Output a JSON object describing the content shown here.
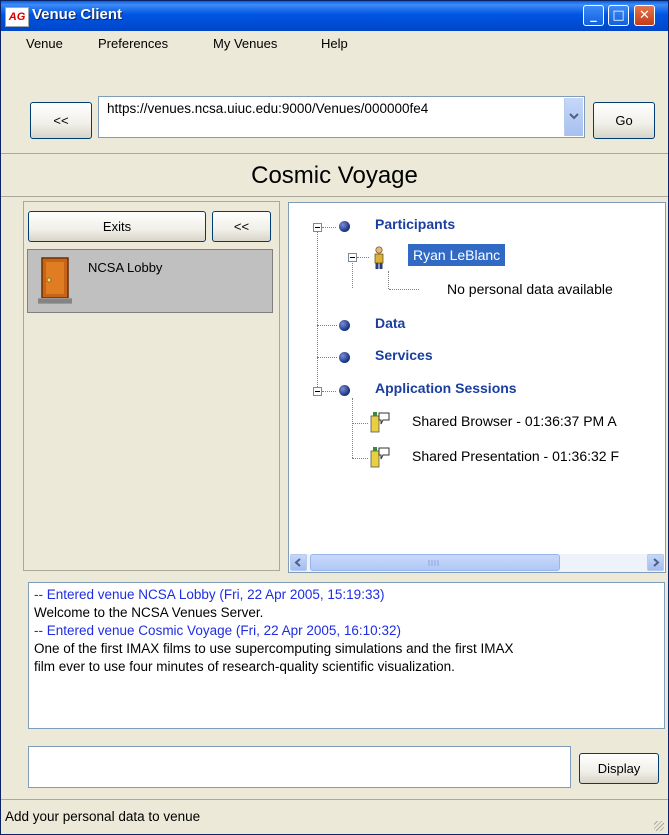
{
  "window": {
    "app_logo_text": "AG",
    "title": "Venue Client",
    "controls": {
      "minimize": "_",
      "maximize": "□",
      "close": "✕"
    }
  },
  "menu": {
    "items": [
      "Venue",
      "Preferences",
      "My Venues",
      "Help"
    ]
  },
  "toolbar": {
    "back_label": "<<",
    "url_value": "https://venues.ncsa.uiuc.edu:9000/Venues/000000fe4",
    "go_label": "Go"
  },
  "venue": {
    "title": "Cosmic Voyage"
  },
  "exits_panel": {
    "exits_label": "Exits",
    "collapse_label": "<<",
    "items": [
      "NCSA Lobby"
    ]
  },
  "tree": {
    "participants_label": "Participants",
    "participant_name": "Ryan LeBlanc",
    "participant_detail": "No personal data available",
    "data_label": "Data",
    "services_label": "Services",
    "app_sessions_label": "Application Sessions",
    "sessions": [
      "Shared Browser - 01:36:37 PM A",
      "Shared Presentation - 01:36:32 F"
    ]
  },
  "log": {
    "lines": [
      {
        "type": "event",
        "text": "-- Entered venue NCSA Lobby (Fri, 22 Apr 2005, 15:19:33)"
      },
      {
        "type": "text",
        "text": "Welcome to the NCSA Venues Server."
      },
      {
        "type": "event",
        "text": "-- Entered venue Cosmic Voyage (Fri, 22 Apr 2005, 16:10:32)"
      },
      {
        "type": "text",
        "text": "One of the first IMAX films to use supercomputing simulations and the first IMAX"
      },
      {
        "type": "text",
        "text": "film ever to use four minutes of research-quality scientific visualization."
      }
    ]
  },
  "chat": {
    "input_value": "",
    "display_label": "Display"
  },
  "status": {
    "text": "Add your personal data to venue"
  },
  "colors": {
    "title_bar": "#0054e3",
    "tree_header": "#1a3fa0",
    "log_event": "#1e2ce6",
    "selection": "#316ac5"
  }
}
